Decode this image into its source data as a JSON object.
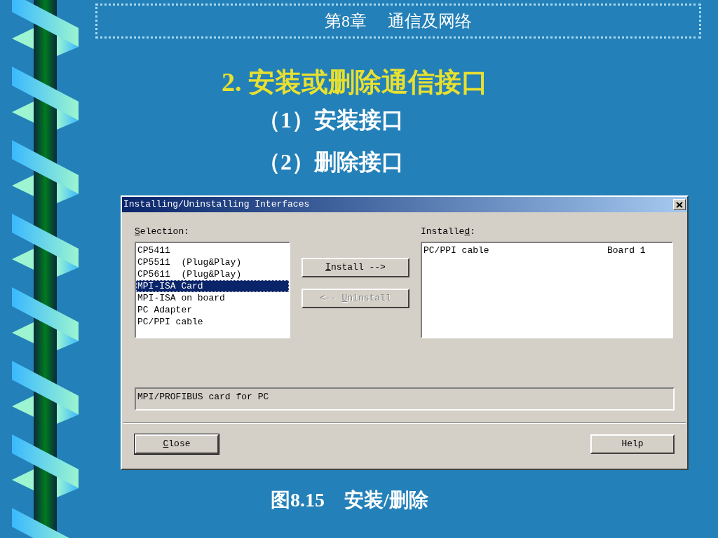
{
  "header": {
    "chapter": "第8章",
    "chapter_title": "通信及网络"
  },
  "heading": "2. 安装或删除通信接口",
  "items": [
    "（1）安装接口",
    "（2）删除接口"
  ],
  "dialog": {
    "title": "Installing/Uninstalling Interfaces",
    "selection_label": {
      "key": "S",
      "post": "election:"
    },
    "selection_items": [
      {
        "text": "CP5411",
        "selected": false
      },
      {
        "text": "CP5511  (Plug&Play)",
        "selected": false
      },
      {
        "text": "CP5611  (Plug&Play)",
        "selected": false
      },
      {
        "text": "MPI-ISA Card",
        "selected": true
      },
      {
        "text": "MPI-ISA on board",
        "selected": false
      },
      {
        "text": "PC Adapter",
        "selected": false
      },
      {
        "text": "PC/PPI cable",
        "selected": false
      }
    ],
    "middle_buttons": [
      {
        "key": "I",
        "post": "nstall -->",
        "disabled": false
      },
      {
        "pre": "<-- ",
        "key": "U",
        "post": "ninstall",
        "disabled": true
      }
    ],
    "installed_label": {
      "pre": "Installe",
      "key": "d",
      "post": ":"
    },
    "installed_items": [
      {
        "name": "PC/PPI cable",
        "board": "Board 1"
      }
    ],
    "description": "MPI/PROFIBUS card for PC",
    "footer_buttons": [
      {
        "key": "C",
        "post": "lose",
        "default": true
      },
      {
        "pre": "Help",
        "default": false
      }
    ]
  },
  "caption": "图8.15　安装/删除"
}
